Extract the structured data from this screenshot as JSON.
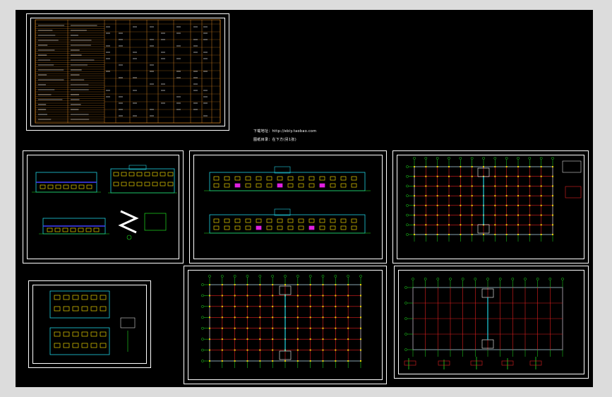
{
  "colors": {
    "background": "#000000",
    "frame": "#ffffff",
    "grid_red": "#e02020",
    "axis_green": "#20e020",
    "wall_cyan": "#20d0e0",
    "window_yellow": "#e8d000",
    "accent_magenta": "#e020e0",
    "table_orange": "#d08020"
  },
  "notes": {
    "line1": "下载地址：http://ebiy.taobao.com",
    "line2": "图纸目录：在下方(另1张)"
  },
  "sheets": [
    {
      "id": "sheet-directory",
      "content": "drawing-index-table"
    },
    {
      "id": "sheet-elevations-sections",
      "content": "elevations-and-sections"
    },
    {
      "id": "sheet-elevations-long",
      "content": "front-and-rear-elevations"
    },
    {
      "id": "sheet-plan-upper",
      "content": "upper-floor-plan"
    },
    {
      "id": "sheet-stair-details",
      "content": "stair-details"
    },
    {
      "id": "sheet-plan-ground",
      "content": "ground-floor-plan"
    },
    {
      "id": "sheet-plan-roof",
      "content": "roof-plan-with-details"
    }
  ]
}
